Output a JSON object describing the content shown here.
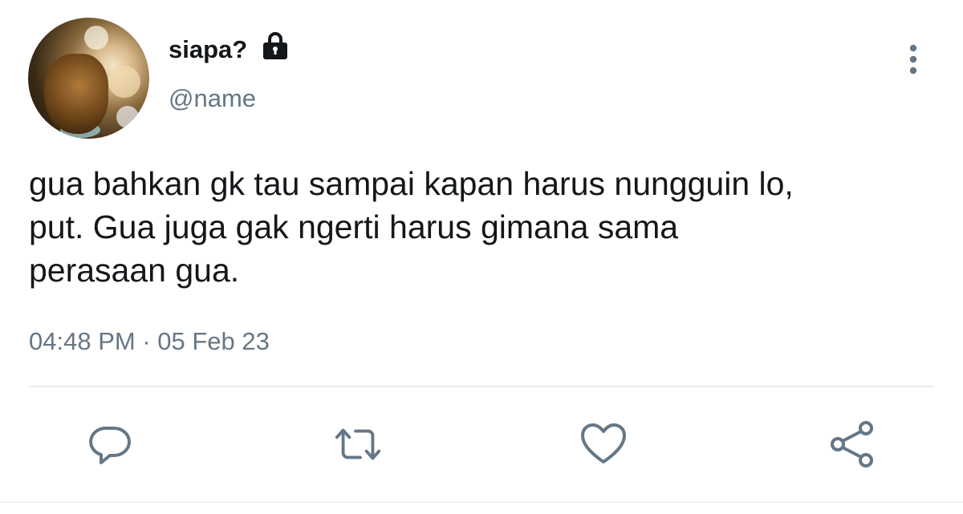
{
  "user": {
    "display_name": "siapa?",
    "handle": "@name",
    "protected_icon": "lock-icon"
  },
  "tweet": {
    "lines": [
      "gua bahkan gk tau sampai kapan harus nungguin lo,",
      "put. Gua juga gak ngerti harus gimana sama",
      "perasaan gua."
    ],
    "timestamp": "04:48 PM · 05 Feb 23"
  },
  "actions": [
    {
      "icon": "reply-icon"
    },
    {
      "icon": "retweet-icon"
    },
    {
      "icon": "like-icon"
    },
    {
      "icon": "share-icon"
    }
  ],
  "menu": {
    "icon": "more-vertical-icon"
  },
  "colors": {
    "text": "#14171a",
    "secondary": "#657786",
    "divider": "#e6ecf0"
  }
}
